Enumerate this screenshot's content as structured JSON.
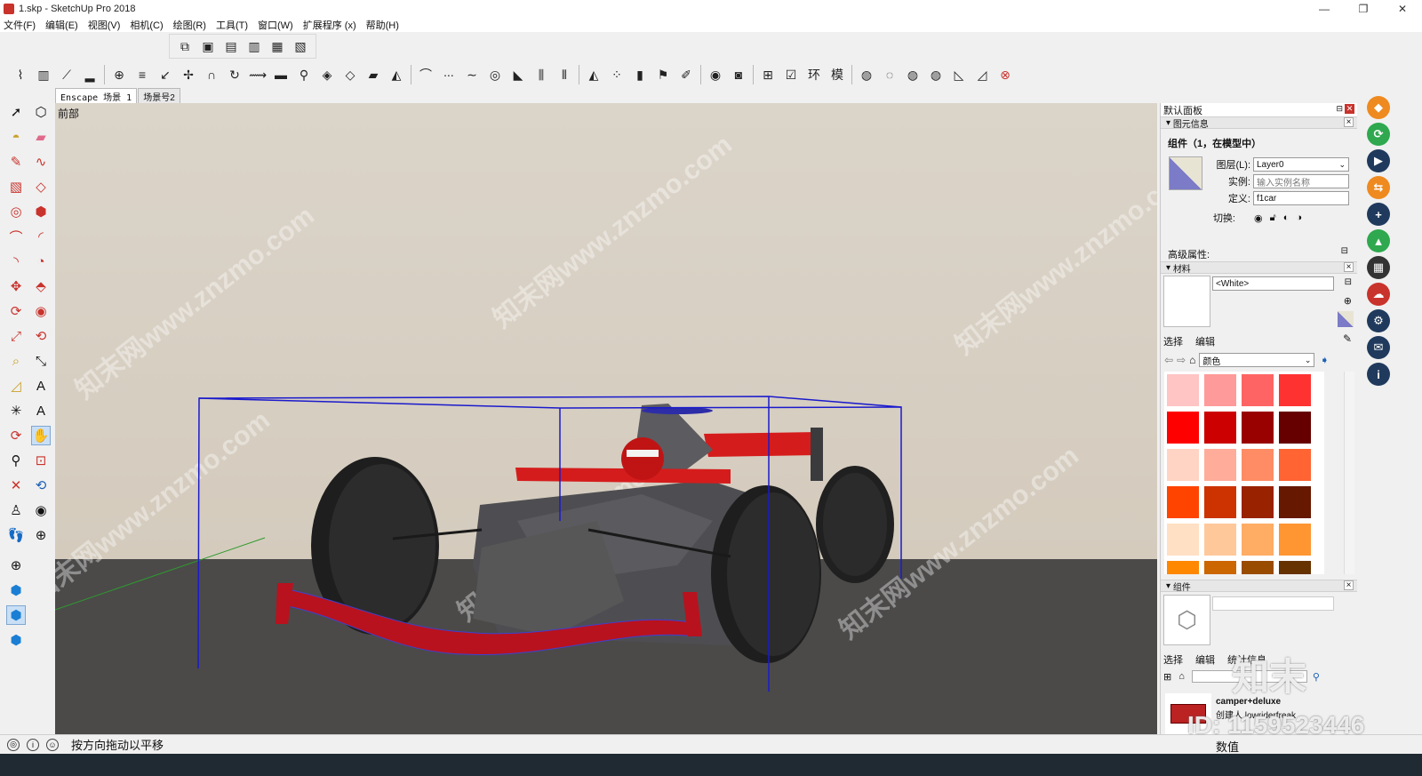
{
  "window": {
    "title": "1.skp - SketchUp Pro 2018",
    "minimize": "—",
    "maximize": "❐",
    "close": "✕"
  },
  "menu": [
    "文件(F)",
    "编辑(E)",
    "视图(V)",
    "相机(C)",
    "绘图(R)",
    "工具(T)",
    "窗口(W)",
    "扩展程序 (x)",
    "帮助(H)"
  ],
  "scene_tabs": [
    "Enscape 场景 1",
    "场景号2"
  ],
  "viewport": {
    "view_label": "前部",
    "watermark": "知末网www.znzmo.com"
  },
  "tray": {
    "title": "默认面板",
    "entity_info": {
      "section": "图元信息",
      "heading": "组件（1，在模型中）",
      "layer_label": "图层(L):",
      "layer_value": "Layer0",
      "instance_label": "实例:",
      "instance_placeholder": "输入实例名称",
      "definition_label": "定义:",
      "definition_value": "f1car",
      "toggle_label": "切换:",
      "advanced_label": "高级属性:"
    },
    "materials": {
      "section": "材料",
      "current": "<White>",
      "tab_select": "选择",
      "tab_edit": "编辑",
      "library": "颜色",
      "swatches": [
        "#ffc4c4",
        "#ff9a9a",
        "#ff6464",
        "#ff3232",
        "#ff0000",
        "#cc0000",
        "#990000",
        "#660000",
        "#ffd4c4",
        "#ffac9a",
        "#ff8c64",
        "#ff6432",
        "#ff4400",
        "#cc3300",
        "#992200",
        "#661800",
        "#ffe0c4",
        "#ffc89a",
        "#ffac64",
        "#ff9632",
        "#ff8800",
        "#cc6600",
        "#994c00",
        "#663200"
      ]
    },
    "components": {
      "section": "组件",
      "tab_select": "选择",
      "tab_edit": "编辑",
      "tab_stats": "统计信息",
      "item_name": "camper+deluxe",
      "item_author": "创建人 lowriderfreak"
    }
  },
  "status": {
    "message": "按方向拖动以平移",
    "measure_label": "数值"
  },
  "overlays": {
    "brand": "知末",
    "id": "ID: 1159523446"
  },
  "colors": {
    "accent": "#c8332c",
    "selection_box": "#1a1acc",
    "ground": "#4b4a49"
  }
}
